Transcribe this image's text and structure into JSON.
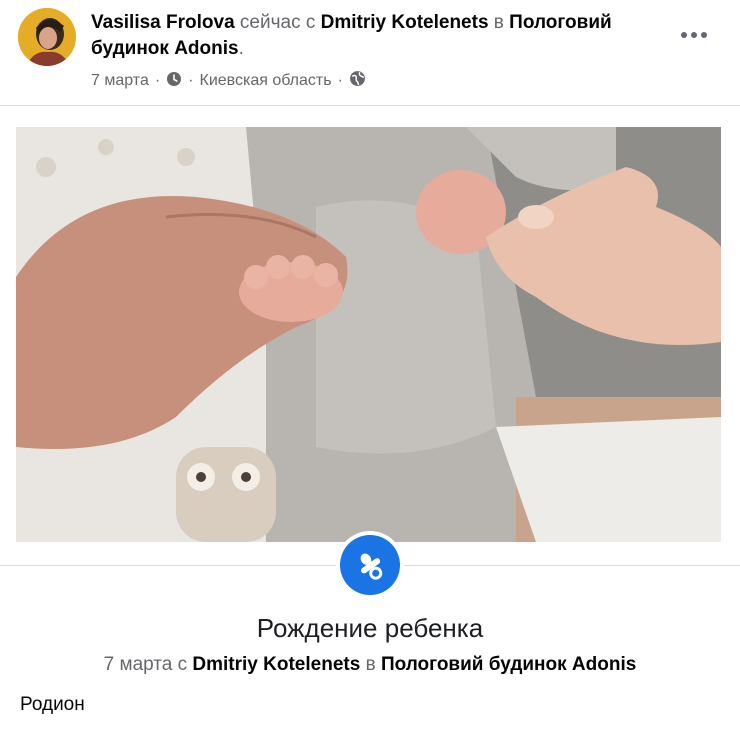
{
  "post": {
    "author": "Vasilisa Frolova",
    "activity": "сейчас с",
    "tagged_person": "Dmitriy Kotelenets",
    "location_prep": "в",
    "place": "Пологовий будинок Adonis",
    "place_end": ".",
    "date": "7 марта",
    "dot": "·",
    "region": "Киевская область"
  },
  "icons": {
    "more": "more-horizontal-icon",
    "clock": "clock-icon",
    "globe": "globe-icon",
    "pacifier": "pacifier-icon"
  },
  "life_event": {
    "title": "Рождение ребенка",
    "date": "7 марта",
    "with": "с",
    "person": "Dmitriy Kotelenets",
    "in": "в",
    "place": "Пологовий будинок Adonis"
  },
  "caption": "Родион",
  "colors": {
    "accent": "#1b74e4",
    "muted": "#65676b",
    "text": "#050505"
  }
}
